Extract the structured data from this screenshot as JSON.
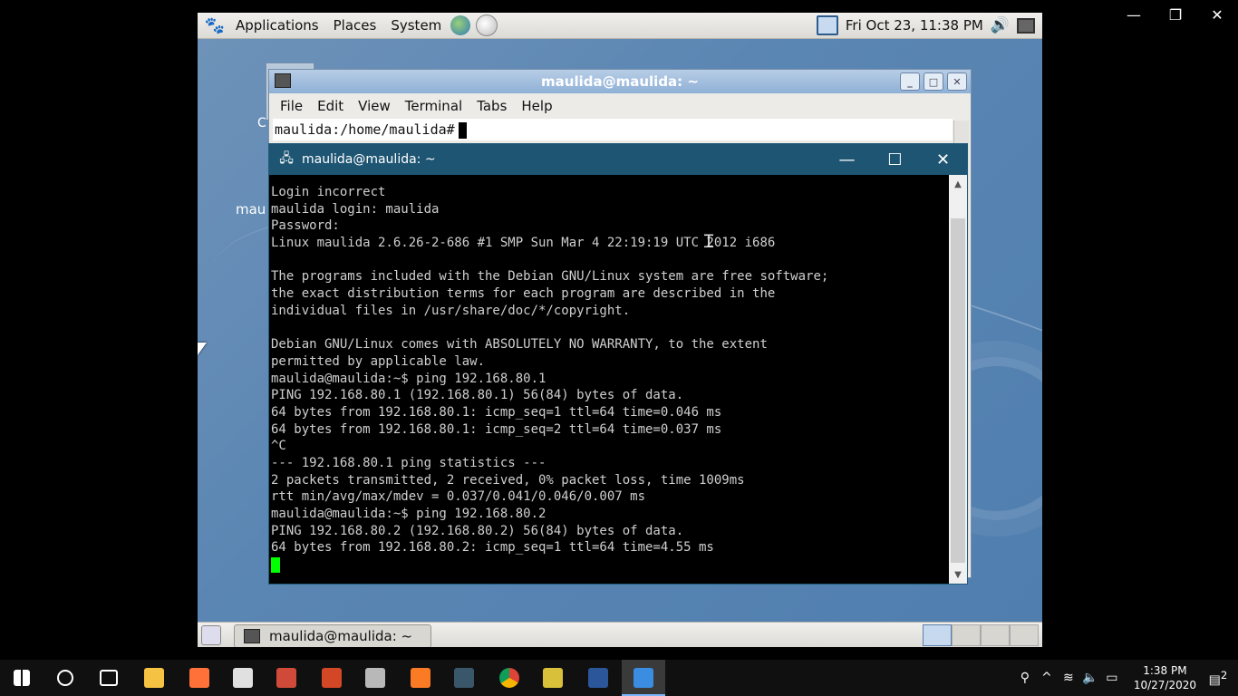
{
  "host_window": {
    "minimize": "—",
    "restore": "❐",
    "close": "✕"
  },
  "gnome_panel": {
    "menus": [
      "Applications",
      "Places",
      "System"
    ],
    "clock": "Fri Oct 23, 11:38 PM"
  },
  "desktop": {
    "label_partial_1": "C",
    "label_partial_2": "mau"
  },
  "gnome_terminal": {
    "title": "maulida@maulida: ~",
    "menu": [
      "File",
      "Edit",
      "View",
      "Terminal",
      "Tabs",
      "Help"
    ],
    "prompt": "maulida:/home/maulida#"
  },
  "putty": {
    "title": "maulida@maulida: ~",
    "lines": [
      "Login incorrect",
      "maulida login: maulida",
      "Password:",
      "Linux maulida 2.6.26-2-686 #1 SMP Sun Mar 4 22:19:19 UTC 2012 i686",
      "",
      "The programs included with the Debian GNU/Linux system are free software;",
      "the exact distribution terms for each program are described in the",
      "individual files in /usr/share/doc/*/copyright.",
      "",
      "Debian GNU/Linux comes with ABSOLUTELY NO WARRANTY, to the extent",
      "permitted by applicable law.",
      "maulida@maulida:~$ ping 192.168.80.1",
      "PING 192.168.80.1 (192.168.80.1) 56(84) bytes of data.",
      "64 bytes from 192.168.80.1: icmp_seq=1 ttl=64 time=0.046 ms",
      "64 bytes from 192.168.80.1: icmp_seq=2 ttl=64 time=0.037 ms",
      "^C",
      "--- 192.168.80.1 ping statistics ---",
      "2 packets transmitted, 2 received, 0% packet loss, time 1009ms",
      "rtt min/avg/max/mdev = 0.037/0.041/0.046/0.007 ms",
      "maulida@maulida:~$ ping 192.168.80.2",
      "PING 192.168.80.2 (192.168.80.2) 56(84) bytes of data.",
      "64 bytes from 192.168.80.2: icmp_seq=1 ttl=64 time=4.55 ms"
    ]
  },
  "gnome_bottom": {
    "task_label": "maulida@maulida: ~"
  },
  "taskbar": {
    "icons": [
      {
        "name": "start-icon",
        "color": "#ffffff"
      },
      {
        "name": "search-circle-icon",
        "color": "#ffffff"
      },
      {
        "name": "task-view-icon",
        "color": "#ffffff"
      },
      {
        "name": "file-explorer-icon",
        "color": "#f5c242"
      },
      {
        "name": "firefox-icon",
        "color": "#ff7139"
      },
      {
        "name": "paint-icon",
        "color": "#e0e0e0"
      },
      {
        "name": "app-icon",
        "color": "#d04a3a"
      },
      {
        "name": "powerpoint-icon",
        "color": "#d24726"
      },
      {
        "name": "image-viewer-icon",
        "color": "#b8b8b8"
      },
      {
        "name": "xampp-icon",
        "color": "#fb7a24"
      },
      {
        "name": "terminal-app-icon",
        "color": "#39566b"
      },
      {
        "name": "chrome-icon",
        "color": "#4caf50"
      },
      {
        "name": "app2-icon",
        "color": "#d8c03a"
      },
      {
        "name": "word-icon",
        "color": "#2b579a"
      },
      {
        "name": "vm-player-icon",
        "color": "#3a8de0"
      }
    ],
    "time": "1:38 PM",
    "date": "10/27/2020",
    "notification_count": "2"
  }
}
